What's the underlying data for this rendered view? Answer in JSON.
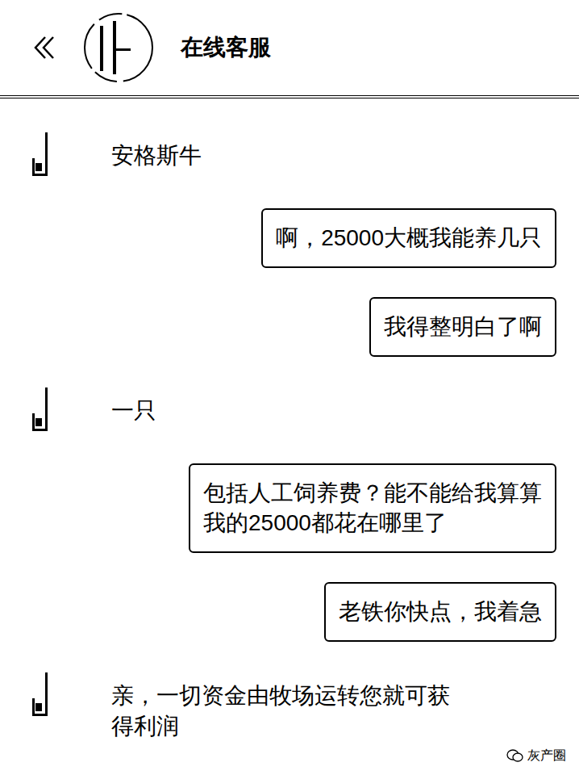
{
  "header": {
    "title": "在线客服"
  },
  "messages": [
    {
      "kind": "received",
      "lines": [
        "安格斯牛"
      ]
    },
    {
      "kind": "sent",
      "lines": [
        "啊，25000大概我能养几只"
      ]
    },
    {
      "kind": "sent",
      "lines": [
        "我得整明白了啊"
      ]
    },
    {
      "kind": "received",
      "lines": [
        "一只"
      ]
    },
    {
      "kind": "sent",
      "lines": [
        "包括人工饲养费？能不能给我算算",
        "我的25000都花在哪里了"
      ]
    },
    {
      "kind": "sent",
      "lines": [
        "老铁你快点，我着急"
      ]
    },
    {
      "kind": "received",
      "lines": [
        "亲，一切资金由牧场运转您就可获",
        "得利润"
      ]
    }
  ],
  "watermark": {
    "text": "灰产圈"
  }
}
